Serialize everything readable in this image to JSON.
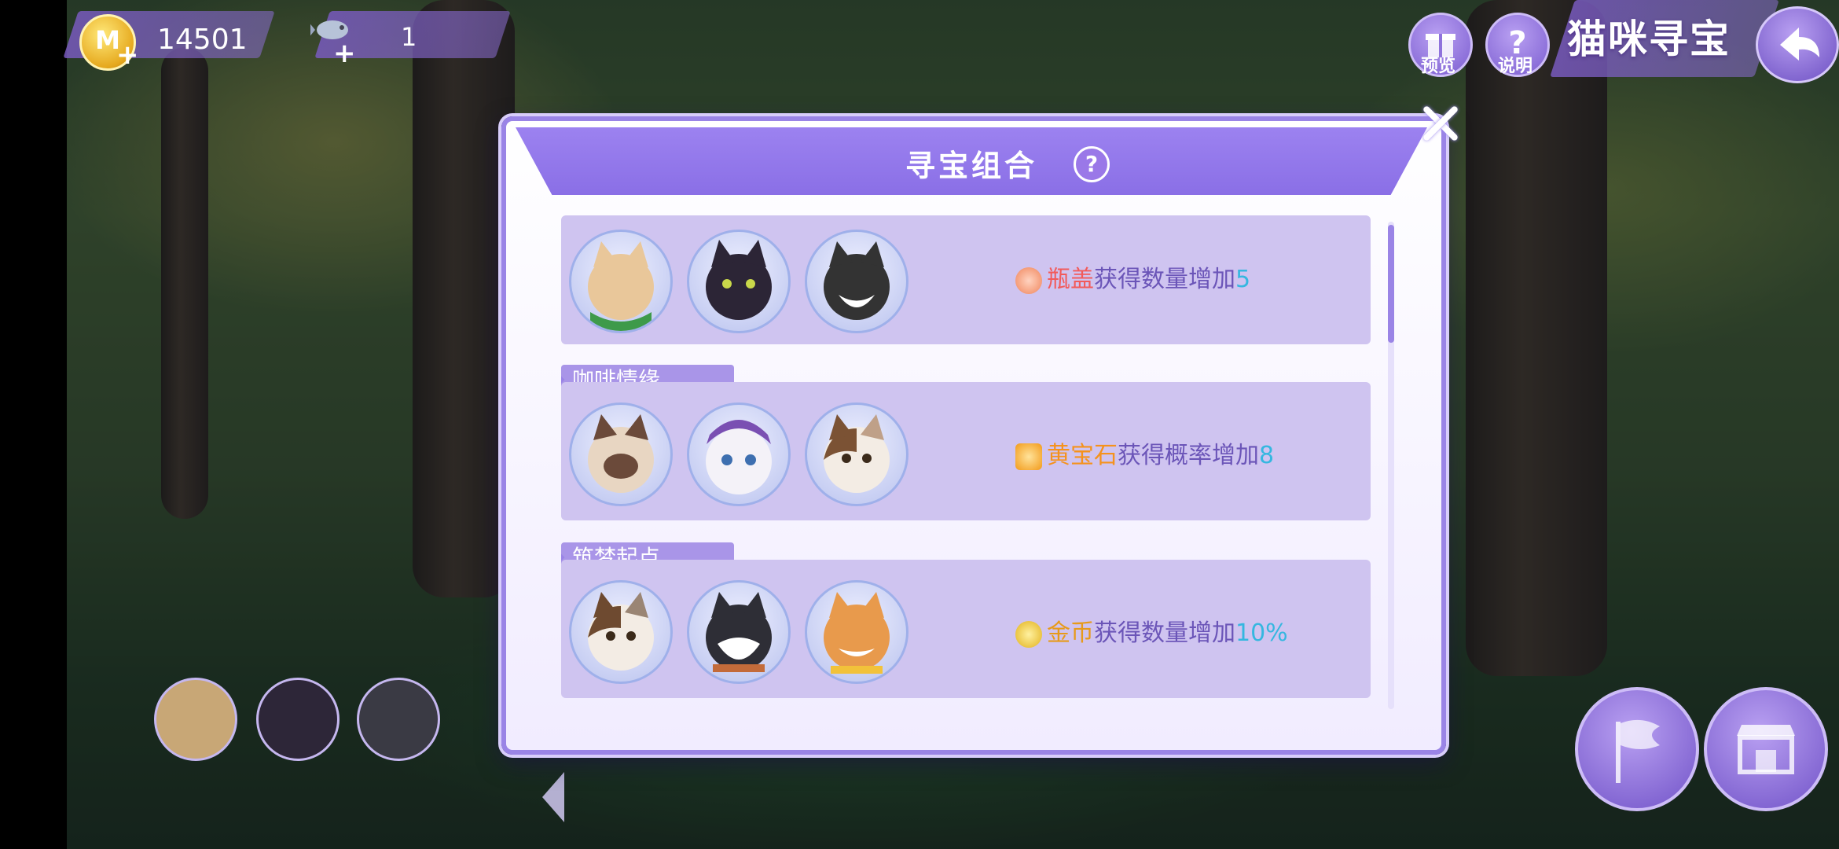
{
  "hud": {
    "coins": "14501",
    "coin_icon_letter": "M",
    "plus": "+",
    "fish_count": "1",
    "preview_label": "预览",
    "help_label": "说明",
    "page_title": "猫咪寻宝"
  },
  "modal": {
    "title": "寻宝组合",
    "help_icon": "?",
    "combos": [
      {
        "name": "",
        "bonus_resource": "瓶盖",
        "bonus_text": "获得数量增加",
        "bonus_value": "5",
        "resource_color": "#f25a5a",
        "icon": "bottle-cap-icon"
      },
      {
        "name": "咖啡情缘",
        "bonus_resource": "黄宝石",
        "bonus_text": "获得概率增加",
        "bonus_value": "8",
        "resource_color": "#f5921c",
        "icon": "topaz-icon"
      },
      {
        "name": "筑梦起点",
        "bonus_resource": "金币",
        "bonus_text": "获得数量增加",
        "bonus_value": "10%",
        "resource_color": "#e79a1a",
        "icon": "gold-coin-icon"
      }
    ]
  },
  "colors": {
    "accent_purple": "#9a84e6",
    "value_blue": "#35b7e0"
  }
}
